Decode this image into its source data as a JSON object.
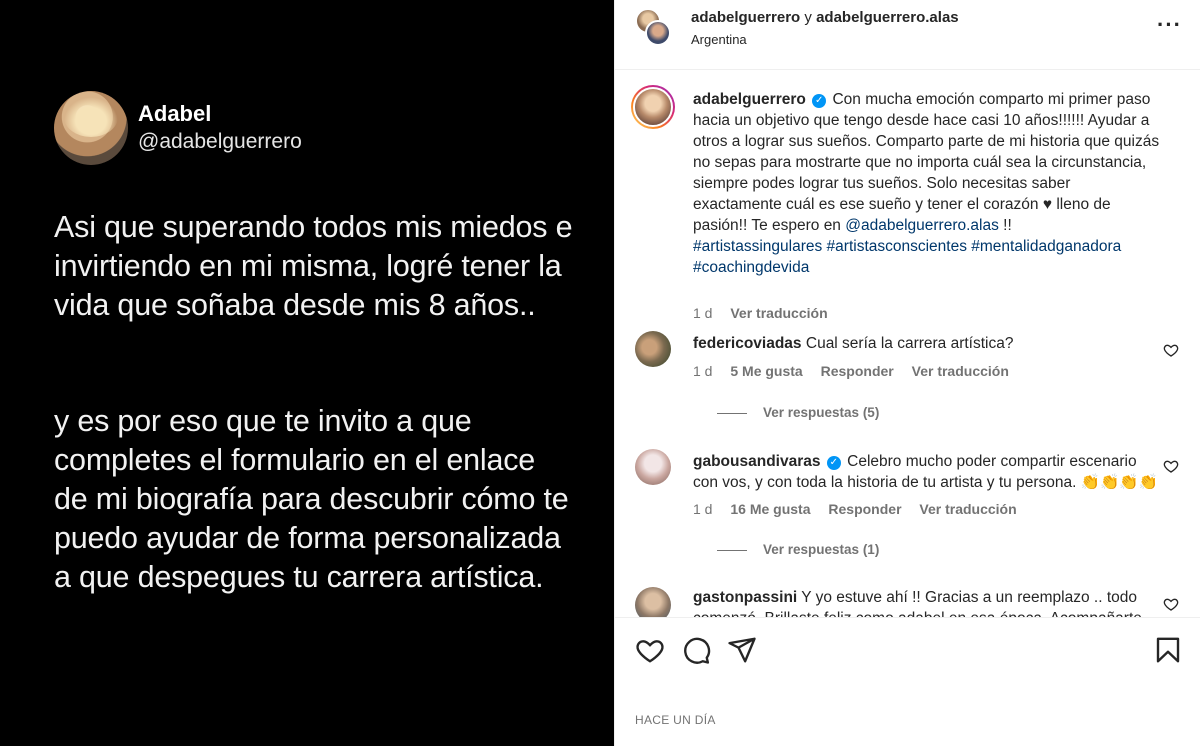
{
  "tweet": {
    "name": "Adabel",
    "handle": "@adabelguerrero",
    "paragraph1": "Asi que superando todos mis miedos e invirtiendo en mi misma, logré tener la vida que soñaba desde mis 8 años..",
    "paragraph2": "y es por eso que te invito a que completes el formulario en el enlace de mi biografía para descubrir cómo te puedo ayudar de forma personalizada a que despegues tu carrera artística."
  },
  "header": {
    "user1": "adabelguerrero",
    "joiner": " y ",
    "user2": "adabelguerrero.alas",
    "location": "Argentina",
    "more_icon": "more-options-icon"
  },
  "caption": {
    "username": "adabelguerrero",
    "text": "Con mucha emoción comparto mi primer paso hacia un objetivo que tengo desde hace casi 10 años!!!!!! Ayudar a otros a lograr sus sueños. Comparto parte de mi historia que quizás no sepas para mostrarte que no importa cuál sea la circunstancia, siempre podes lograr tus sueños. Solo necesitas saber exactamente cuál es ese sueño y tener el corazón ♥ lleno de pasión!! Te espero en ",
    "mention": "@adabelguerrero.alas",
    "after_mention": " !!",
    "hashtags": "#artistassingulares #artistasconscientes #mentalidadganadora #coachingdevida",
    "time": "1 d",
    "translate": "Ver traducción"
  },
  "comments": [
    {
      "username": "federicoviadas",
      "text": "Cual sería la carrera artística?",
      "time": "1 d",
      "likes": "5 Me gusta",
      "reply": "Responder",
      "translate": "Ver traducción",
      "view_replies": "Ver respuestas (5)"
    },
    {
      "username": "gabousandivaras",
      "text": "Celebro mucho poder compartir escenario con vos, y con toda la historia de tu artista y tu persona. 👏👏👏👏",
      "time": "1 d",
      "likes": "16 Me gusta",
      "reply": "Responder",
      "translate": "Ver traducción",
      "view_replies": "Ver respuestas (1)"
    },
    {
      "username": "gastonpassini",
      "text": "Y yo estuve ahí !! Gracias a un reemplazo .. todo comenzó. Brillaste feliz como adabel en esa época. Acompañarte"
    }
  ],
  "actions": {
    "like_icon": "heart-icon",
    "comment_icon": "comment-icon",
    "share_icon": "share-icon",
    "save_icon": "bookmark-icon"
  },
  "footer": {
    "timestamp": "HACE UN DÍA"
  }
}
